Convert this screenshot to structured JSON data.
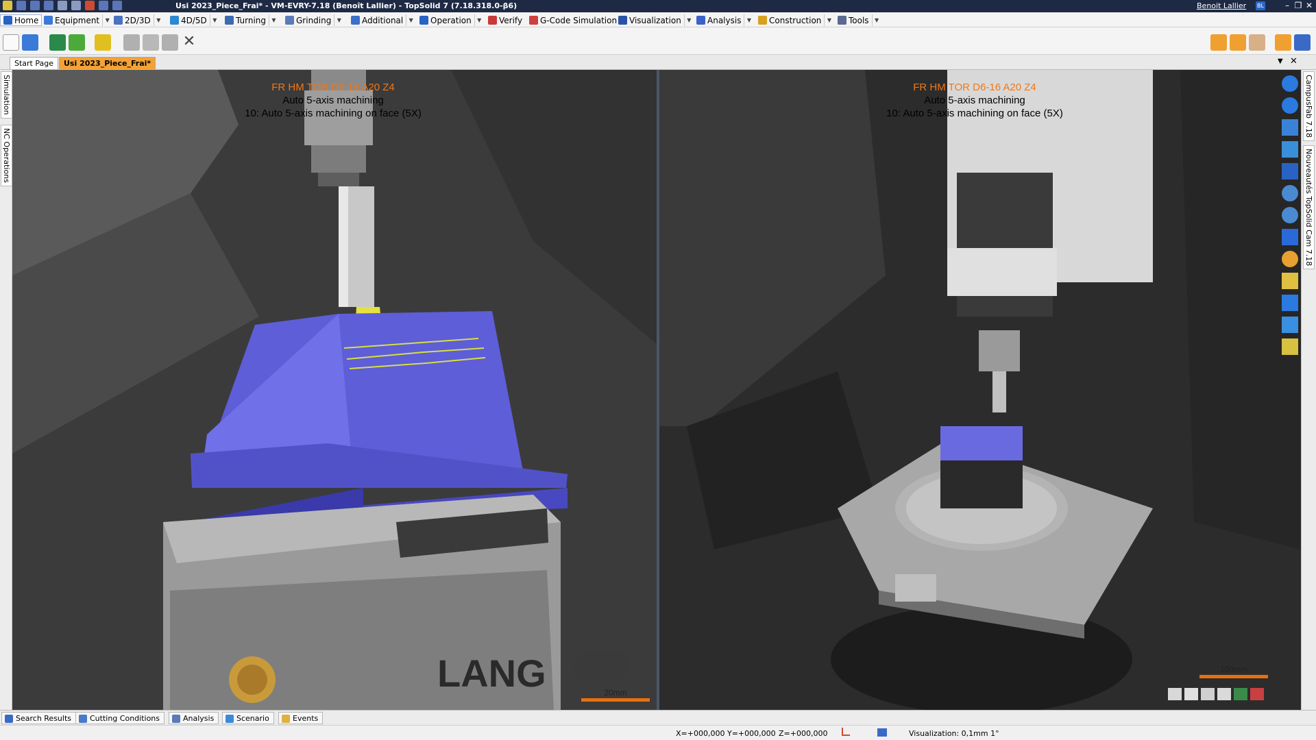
{
  "window": {
    "title": "Usi 2023_Piece_Frai* - VM-EVRY-7.18 (Benoît Lallier) - TopSolid 7 (7.18.318.0-β6)",
    "user": "Benoit Lallier",
    "user_badge": "BL",
    "minimize": "–",
    "restore": "❐",
    "close": "✕"
  },
  "menu": [
    {
      "label": "Home",
      "color": "#2a62c4"
    },
    {
      "label": "Equipment",
      "color": "#3a7ad8"
    },
    {
      "label": "2D/3D",
      "color": "#4a72c0"
    },
    {
      "label": "4D/5D",
      "color": "#2c88d0"
    },
    {
      "label": "Turning",
      "color": "#3c6ab0"
    },
    {
      "label": "Grinding",
      "color": "#5a7ab8"
    },
    {
      "label": "Additional",
      "color": "#3c70c8"
    },
    {
      "label": "Operation",
      "color": "#2a62c4"
    },
    {
      "label": "Verify",
      "color": "#c83a3a"
    },
    {
      "label": "G-Code Simulation",
      "color": "#d04040"
    },
    {
      "label": "Visualization",
      "color": "#2a52a8"
    },
    {
      "label": "Analysis",
      "color": "#3a62c8"
    },
    {
      "label": "Construction",
      "color": "#d6a020"
    },
    {
      "label": "Tools",
      "color": "#5a6a90"
    }
  ],
  "doc_tabs": {
    "start": "Start Page",
    "active": "Usi 2023_Piece_Frai*"
  },
  "left_panel": {
    "tab1": "Simulation",
    "tab2": "NC Operations"
  },
  "right_panel": {
    "tab1": "CampusFab 7.18",
    "tab2": "Nouveautés TopSolid Cam 7.18"
  },
  "viewport_left": {
    "tool": "FR HM TOR D6-16 A20 Z4",
    "line1": "Auto 5-axis machining",
    "line2": "10: Auto 5-axis machining on face (5X)",
    "scale": "20mm"
  },
  "viewport_right": {
    "tool": "FR HM TOR D6-16 A20 Z4",
    "line1": "Auto 5-axis machining",
    "line2": "10: Auto 5-axis machining on face (5X)",
    "scale": "100mm"
  },
  "vise_brand": "LANG",
  "bottom_tabs": [
    "Search Results",
    "Cutting Conditions",
    "Analysis",
    "Scenario",
    "Events"
  ],
  "status": {
    "x": "X=+000,000",
    "y": "Y=+000,000",
    "z": "Z=+000,000",
    "visualization": "Visualization: 0,1mm 1°"
  }
}
